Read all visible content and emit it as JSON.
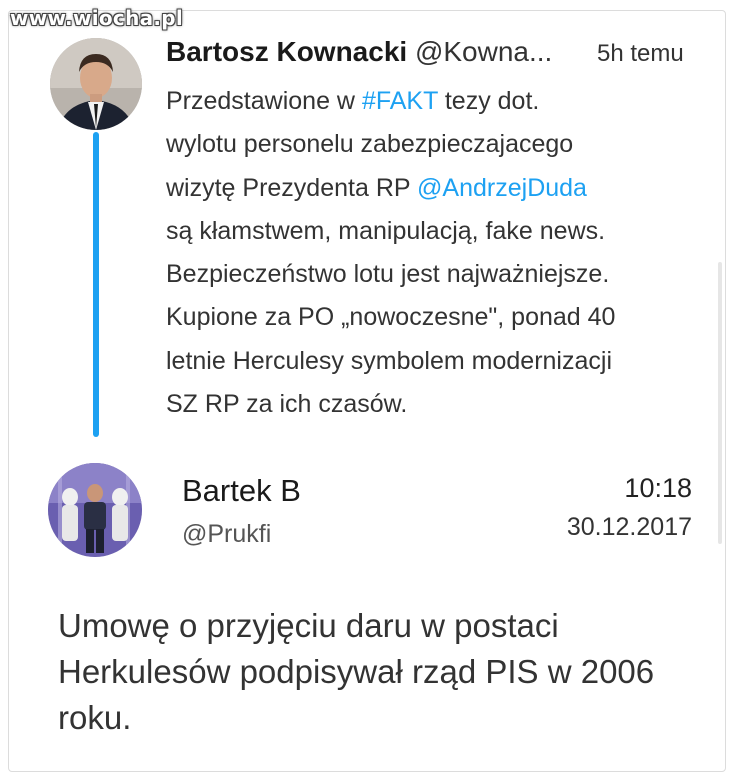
{
  "watermark": "www.wiocha.pl",
  "tweet1": {
    "author_name": "Bartosz Kownacki",
    "author_handle": "@Kowna...",
    "time": "5h temu",
    "line1_pre": "Przedstawione w ",
    "line1_hashtag": "#FAKT",
    "line1_post": " tezy dot.",
    "line2": "wylotu personelu zabezpieczajacego",
    "line3_pre": "wizytę Prezydenta RP ",
    "line3_mention": "@AndrzejDuda",
    "line4": "są kłamstwem, manipulacją, fake news.",
    "line5": "Bezpieczeństwo lotu jest najważniejsze.",
    "line6": "Kupione za PO „nowoczesne\", ponad 40",
    "line7": "letnie Herculesy symbolem modernizacji",
    "line8": "SZ RP za ich czasów."
  },
  "tweet2": {
    "author_name": "Bartek B",
    "author_handle": "@Prukfi",
    "time": "10:18",
    "date": "30.12.2017",
    "line1": "Umowę o przyjęciu daru w postaci",
    "line2": "Herkulesów podpisywał rząd PIS w 2006",
    "line3": "roku."
  },
  "colors": {
    "link": "#1da1f2",
    "thread_line": "#1da1f2",
    "text": "#333333"
  }
}
